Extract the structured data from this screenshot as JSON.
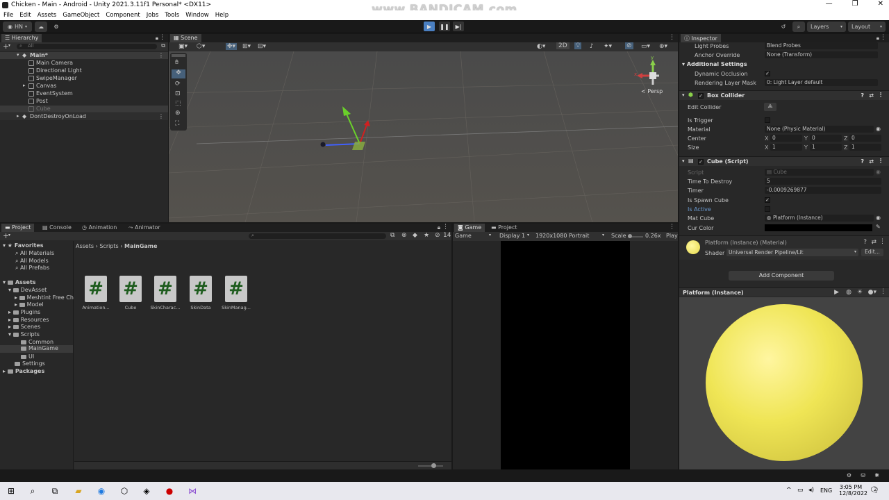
{
  "window": {
    "title": "Chicken - Main - Android - Unity 2021.3.11f1 Personal* <DX11>",
    "controls": [
      "—",
      "❐",
      "✕"
    ]
  },
  "watermark": "www.BANDICAM.com",
  "menu": [
    "File",
    "Edit",
    "Assets",
    "GameObject",
    "Component",
    "Jobs",
    "Tools",
    "Window",
    "Help"
  ],
  "toolbar": {
    "account": "HN",
    "layers": "Layers",
    "layout": "Layout"
  },
  "hierarchy": {
    "tab": "Hierarchy",
    "search_placeholder": "All",
    "scene": "Main*",
    "items": [
      "Main Camera",
      "Directional Light",
      "SwipeManager",
      "Canvas",
      "EventSystem",
      "Post",
      "Cube"
    ],
    "dont_destroy": "DontDestroyOnLoad"
  },
  "scene": {
    "tab": "Scene",
    "mode_2d": "2D",
    "persp": "Persp",
    "gizmo_x": "x",
    "gizmo_y": "y"
  },
  "inspector": {
    "tab": "Inspector",
    "rows_top": [
      {
        "label": "Light Probes",
        "value": "Blend Probes"
      },
      {
        "label": "Anchor Override",
        "value": "None (Transform)"
      }
    ],
    "additional_settings": "Additional Settings",
    "dynamic_occlusion": "Dynamic Occlusion",
    "rendering_layer_mask": {
      "label": "Rendering Layer Mask",
      "value": "0: Light Layer default"
    },
    "box_collider": {
      "title": "Box Collider",
      "edit_collider": "Edit Collider",
      "is_trigger": "Is Trigger",
      "material": {
        "label": "Material",
        "value": "None (Physic Material)"
      },
      "center": {
        "label": "Center",
        "x": "0",
        "y": "0",
        "z": "0"
      },
      "size": {
        "label": "Size",
        "x": "1",
        "y": "1",
        "z": "1"
      }
    },
    "cube_script": {
      "title": "Cube (Script)",
      "script": {
        "label": "Script",
        "value": "Cube"
      },
      "time_to_destroy": {
        "label": "Time To Destroy",
        "value": "5"
      },
      "timer": {
        "label": "Timer",
        "value": "-0.0009269877"
      },
      "is_spawn_cube": "Is Spawn Cube",
      "is_active": "Is Active",
      "mat_cube": {
        "label": "Mat Cube",
        "value": "Platform (Instance)"
      },
      "cur_color": "Cur Color"
    },
    "material": {
      "title": "Platform (Instance) (Material)",
      "shader_label": "Shader",
      "shader_value": "Universal Render Pipeline/Lit",
      "edit": "Edit..."
    },
    "add_component": "Add Component",
    "preview_title": "Platform (Instance)",
    "preview_color": "#efe555"
  },
  "project": {
    "tabs": [
      "Project",
      "Console",
      "Animation",
      "Animator"
    ],
    "count": "14",
    "breadcrumb": [
      "Assets",
      "Scripts",
      "MainGame"
    ],
    "favorites": {
      "title": "Favorites",
      "items": [
        "All Materials",
        "All Models",
        "All Prefabs"
      ]
    },
    "assets_tree": {
      "title": "Assets",
      "items": [
        "DevAsset",
        "Meshtint Free Ch",
        "Model",
        "Plugins",
        "Resources",
        "Scenes",
        "Scripts",
        "Common",
        "MainGame",
        "UI",
        "Settings"
      ],
      "packages": "Packages"
    },
    "files": [
      "Animation...",
      "Cube",
      "SkinCharac...",
      "SkinData",
      "SkinManag..."
    ]
  },
  "game": {
    "tabs": [
      "Game",
      "Project"
    ],
    "mode": "Game",
    "display": "Display 1",
    "resolution": "1920x1080 Portrait",
    "scale_label": "Scale",
    "scale_value": "0.26x",
    "play": "Play"
  },
  "taskbar": {
    "lang": "ENG",
    "time": "3:05 PM",
    "date": "12/8/2022",
    "notifications": "2"
  }
}
